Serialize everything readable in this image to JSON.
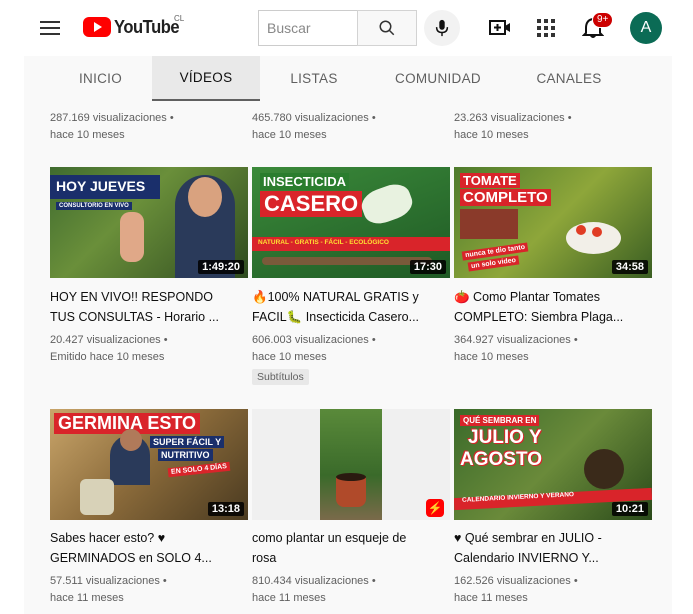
{
  "header": {
    "logo_text": "YouTube",
    "country_code": "CL",
    "search_placeholder": "Buscar",
    "notification_count": "9+",
    "avatar_letter": "A"
  },
  "tabs": [
    {
      "label": "INICIO",
      "active": false
    },
    {
      "label": "VÍDEOS",
      "active": true
    },
    {
      "label": "LISTAS",
      "active": false
    },
    {
      "label": "COMUNIDAD",
      "active": false
    },
    {
      "label": "CANALES",
      "active": false
    }
  ],
  "partial_row": [
    {
      "views": "287.169 visualizaciones •",
      "age": "hace 10 meses"
    },
    {
      "views": "465.780 visualizaciones •",
      "age": "hace 10 meses"
    },
    {
      "views": "23.263 visualizaciones •",
      "age": "hace 10 meses"
    }
  ],
  "videos": [
    {
      "title_line1": "HOY EN VIVO!! RESPONDO",
      "title_line2": "TUS CONSULTAS - Horario ...",
      "views": "20.427 visualizaciones •",
      "age": "Emitido hace 10 meses",
      "duration": "1:49:20",
      "thumb_text": [
        "HOY JUEVES",
        "CONSULTORIO EN VIVO"
      ]
    },
    {
      "title_line1": "🔥100% NATURAL GRATIS y",
      "title_line2": "FACIL🐛 Insecticida Casero...",
      "views": "606.003 visualizaciones •",
      "age": "hace 10 meses",
      "chip": "Subtítulos",
      "duration": "17:30",
      "thumb_text": [
        "INSECTICIDA",
        "CASERO",
        "NATURAL - GRATIS - FÁCIL - ECOLÓGICO"
      ]
    },
    {
      "title_line1": "🍅 Como Plantar Tomates",
      "title_line2": "COMPLETO: Siembra Plaga...",
      "views": "364.927 visualizaciones •",
      "age": "hace 10 meses",
      "duration": "34:58",
      "thumb_text": [
        "TOMATE",
        "COMPLETO",
        "nunca te dio tanto",
        "un solo video"
      ]
    },
    {
      "title_line1": "Sabes hacer esto? ♥",
      "title_line2": "GERMINADOS en SOLO 4...",
      "views": "57.511 visualizaciones •",
      "age": "hace 11 meses",
      "duration": "13:18",
      "thumb_text": [
        "GERMINA ESTO",
        "SUPER FÁCIL Y",
        "NUTRITIVO",
        "EN SOLO 4 DÍAS"
      ]
    },
    {
      "title_line1": "como plantar un esqueje de",
      "title_line2": "rosa",
      "views": "810.434 visualizaciones •",
      "age": "hace 11 meses",
      "duration": ""
    },
    {
      "title_line1": "♥ Qué sembrar en JULIO -",
      "title_line2": "Calendario INVIERNO Y...",
      "views": "162.526 visualizaciones •",
      "age": "hace 11 meses",
      "duration": "10:21",
      "thumb_text": [
        "QUÉ SEMBRAR EN",
        "JULIO Y",
        "AGOSTO",
        "CALENDARIO INVIERNO Y VERANO"
      ]
    }
  ]
}
